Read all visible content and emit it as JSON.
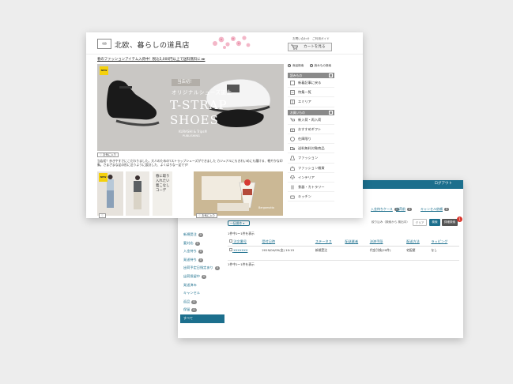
{
  "admin": {
    "logout": "ログアウト",
    "filters": [
      {
        "label": "入金待ちケース",
        "count": "0"
      },
      {
        "label": "出荷前",
        "count": "0"
      },
      {
        "label": "キャンセル依頼",
        "count": "0"
      }
    ],
    "bulk_select": "一括操作 ▾",
    "search_summary": "絞り込み（検索から 検出中）",
    "buttons": {
      "clear": "クリア",
      "search": "検索",
      "detail": "詳細検索"
    },
    "badge": "1",
    "count_top": "1件中1〜1件を表示",
    "count_bottom": "1件中1〜1件を表示",
    "side": [
      {
        "label": "新規受注",
        "count": "0"
      },
      {
        "label": "要対応",
        "count": "0"
      },
      {
        "label": "入金待ち",
        "count": "0"
      },
      {
        "label": "発送待ち",
        "count": "0"
      },
      {
        "label": "出荷予定日指定あり",
        "count": "0"
      },
      {
        "label": "出荷保留中",
        "count": "0"
      },
      {
        "label": "発送済み",
        "count": ""
      },
      {
        "label": "キャンセル",
        "count": ""
      },
      {
        "label": "返品",
        "count": "0"
      },
      {
        "label": "保留",
        "count": "0"
      },
      {
        "label": "すべて",
        "count": ""
      }
    ],
    "columns": [
      "注文番号",
      "受付日時",
      "ステータス",
      "配送業者",
      "決済手段",
      "配送方法",
      "ラッピング"
    ],
    "rows": [
      [
        "XXXXXXX",
        "2019/04/05(金) 10:15",
        "新規受注",
        "",
        "代金引換(20件)",
        "宅配便",
        "なし"
      ]
    ]
  },
  "shop": {
    "logo_text": "北欧、暮らしの道具店",
    "title": "北欧、暮らしの道具店",
    "toplinks": "お問い合わせ　ご利用ガイド",
    "cart": "カートを見る",
    "announcement": "春のファッションアイテム入荷中！税込5,000円以上で送料無料に ▸▸",
    "hero": {
      "new": "NEW",
      "badge": "当店初！",
      "subtitle": "オリジナルシューズ誕生",
      "title_line1": "T-STRAP",
      "title_line2": "SHOES",
      "credit1": "KURASHI & Trips®",
      "credit2": "PUBLISHING"
    },
    "fav_label": "お気に入り",
    "caption": "当店初！歩きやすさにこだわりました。大人のためのTストラップシューズができました カジュアルにもきれいめにも履ける、軽やかな印象。さまざまな足の形に沿うように設計した、よくばりな一足です！",
    "thumb_new": "NEW",
    "thumb3_text": "春に取り入れたい着こなしコーデ",
    "thumb4_tag": "Bergamotto",
    "side": {
      "radio1": "商品検索",
      "radio2": "読みもの検索",
      "head1": "読みもの",
      "items1": [
        "新着記事に戻る",
        "特集一覧",
        "エミリア"
      ],
      "head2": "お買いもの",
      "items2": [
        "新入荷・再入荷",
        "おすすめギフト",
        "在庫限り",
        "送料無料対象商品",
        "ファッション",
        "ファッション雑貨",
        "インテリア",
        "食器・カトラリー",
        "キッチン"
      ]
    }
  }
}
